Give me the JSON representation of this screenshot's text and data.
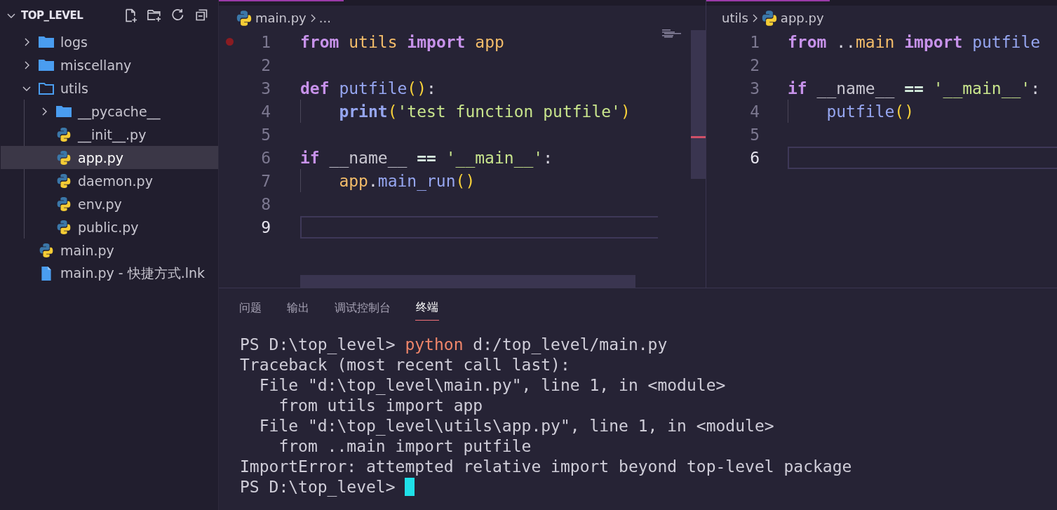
{
  "explorer": {
    "title": "TOP_LEVEL",
    "expanded": true,
    "items": [
      {
        "label": "logs",
        "kind": "folder",
        "expanded": false,
        "selected": false
      },
      {
        "label": "miscellany",
        "kind": "folder",
        "expanded": false,
        "selected": false
      },
      {
        "label": "utils",
        "kind": "folder",
        "expanded": true,
        "selected": false,
        "children": [
          {
            "label": "__pycache__",
            "kind": "folder",
            "expanded": false,
            "selected": false
          },
          {
            "label": "__init__.py",
            "kind": "python",
            "selected": false
          },
          {
            "label": "app.py",
            "kind": "python",
            "selected": true
          },
          {
            "label": "daemon.py",
            "kind": "python",
            "selected": false
          },
          {
            "label": "env.py",
            "kind": "python",
            "selected": false
          },
          {
            "label": "public.py",
            "kind": "python",
            "selected": false
          }
        ]
      },
      {
        "label": "main.py",
        "kind": "python",
        "selected": false
      },
      {
        "label": "main.py - 快捷方式.lnk",
        "kind": "file",
        "selected": false
      }
    ]
  },
  "editors": [
    {
      "breadcrumb": [
        {
          "label": "main.py",
          "kind": "python"
        },
        {
          "label": "...",
          "kind": "symbols"
        }
      ],
      "lines": [
        {
          "number": "1",
          "breakpoint": true,
          "current": false,
          "tokens": [
            {
              "text": "from ",
              "kind": "kw"
            },
            {
              "text": "utils ",
              "kind": "mod"
            },
            {
              "text": "import ",
              "kind": "kw"
            },
            {
              "text": "app",
              "kind": "mod"
            }
          ]
        },
        {
          "number": "2",
          "breakpoint": false,
          "current": false
        },
        {
          "number": "3",
          "breakpoint": false,
          "current": false,
          "tokens": [
            {
              "text": "def ",
              "kind": "kw"
            },
            {
              "text": "putfile",
              "kind": "fn"
            },
            {
              "text": "()",
              "kind": "paren"
            },
            {
              "text": ":",
              "kind": "plain"
            }
          ]
        },
        {
          "number": "4",
          "breakpoint": false,
          "current": false,
          "indent": true,
          "tokens": [
            {
              "text": "print",
              "kind": "builtin"
            },
            {
              "text": "(",
              "kind": "paren"
            },
            {
              "text": "'test function putfile'",
              "kind": "str"
            },
            {
              "text": ")",
              "kind": "paren"
            }
          ]
        },
        {
          "number": "5",
          "breakpoint": false,
          "current": false
        },
        {
          "number": "6",
          "breakpoint": false,
          "current": false,
          "tokens": [
            {
              "text": "if ",
              "kind": "kw"
            },
            {
              "text": "__name__ ",
              "kind": "var"
            },
            {
              "text": "== ",
              "kind": "op"
            },
            {
              "text": "'__main__'",
              "kind": "str"
            },
            {
              "text": ":",
              "kind": "plain"
            }
          ]
        },
        {
          "number": "7",
          "breakpoint": false,
          "current": false,
          "indent": true,
          "tokens": [
            {
              "text": "app",
              "kind": "mod"
            },
            {
              "text": ".",
              "kind": "plain"
            },
            {
              "text": "main_run",
              "kind": "fn"
            },
            {
              "text": "()",
              "kind": "paren"
            }
          ]
        },
        {
          "number": "8",
          "breakpoint": false,
          "current": false
        },
        {
          "number": "9",
          "breakpoint": false,
          "current": true
        }
      ]
    },
    {
      "breadcrumb": [
        {
          "label": "utils",
          "kind": "folder"
        },
        {
          "label": "app.py",
          "kind": "python"
        }
      ],
      "lines": [
        {
          "number": "1",
          "breakpoint": false,
          "current": false,
          "tokens": [
            {
              "text": "from ",
              "kind": "kw"
            },
            {
              "text": "..",
              "kind": "plain"
            },
            {
              "text": "main ",
              "kind": "mod"
            },
            {
              "text": "import ",
              "kind": "kw"
            },
            {
              "text": "putfile",
              "kind": "fn"
            }
          ]
        },
        {
          "number": "2",
          "breakpoint": false,
          "current": false
        },
        {
          "number": "3",
          "breakpoint": false,
          "current": false,
          "tokens": [
            {
              "text": "if ",
              "kind": "kw"
            },
            {
              "text": "__name__ ",
              "kind": "var"
            },
            {
              "text": "== ",
              "kind": "op"
            },
            {
              "text": "'__main__'",
              "kind": "str"
            },
            {
              "text": ":",
              "kind": "plain"
            }
          ]
        },
        {
          "number": "4",
          "breakpoint": false,
          "current": false,
          "indent": true,
          "tokens": [
            {
              "text": "putfile",
              "kind": "fn"
            },
            {
              "text": "()",
              "kind": "paren"
            }
          ]
        },
        {
          "number": "5",
          "breakpoint": false,
          "current": false
        },
        {
          "number": "6",
          "breakpoint": false,
          "current": true
        }
      ]
    }
  ],
  "panel": {
    "tabs": [
      {
        "label": "问题",
        "selected": false
      },
      {
        "label": "输出",
        "selected": false
      },
      {
        "label": "调试控制台",
        "selected": false
      },
      {
        "label": "终端",
        "selected": true
      }
    ],
    "terminal": {
      "cursor": true,
      "lines": [
        [
          {
            "text": "PS D:\\top_level> ",
            "kind": "plain"
          },
          {
            "text": "python",
            "kind": "cmd"
          },
          {
            "text": " d:/top_level/main.py",
            "kind": "plain"
          }
        ],
        [
          {
            "text": "Traceback (most recent call last):",
            "kind": "plain"
          }
        ],
        [
          {
            "text": "  File \"d:\\top_level\\main.py\", line 1, in <module>",
            "kind": "plain"
          }
        ],
        [
          {
            "text": "    from utils import app",
            "kind": "plain"
          }
        ],
        [
          {
            "text": "  File \"d:\\top_level\\utils\\app.py\", line 1, in <module>",
            "kind": "plain"
          }
        ],
        [
          {
            "text": "    from ..main import putfile",
            "kind": "plain"
          }
        ],
        [
          {
            "text": "ImportError: attempted relative import beyond top-level package",
            "kind": "plain"
          }
        ],
        [
          {
            "text": "PS D:\\top_level> ",
            "kind": "plain"
          }
        ]
      ]
    }
  }
}
